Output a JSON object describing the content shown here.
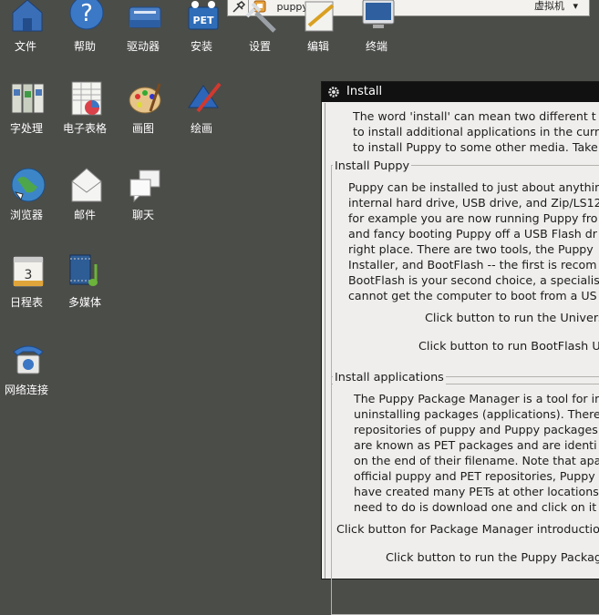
{
  "desktop": {
    "icons": [
      {
        "label": "文件"
      },
      {
        "label": "帮助"
      },
      {
        "label": "驱动器"
      },
      {
        "label": "安装"
      },
      {
        "label": "设置"
      },
      {
        "label": "编辑"
      },
      {
        "label": "终端"
      },
      {
        "label": "字处理"
      },
      {
        "label": "电子表格"
      },
      {
        "label": "画图"
      },
      {
        "label": "绘画"
      },
      {
        "label": "浏览器"
      },
      {
        "label": "邮件"
      },
      {
        "label": "聊天"
      },
      {
        "label": "日程表"
      },
      {
        "label": "多媒体"
      },
      {
        "label": "网络连接"
      }
    ],
    "install_icon_badge": "PET",
    "calendar_day": "3"
  },
  "taskbar": {
    "task_label": "puppy",
    "vm_label": "虚拟机",
    "vm_arrow": "▾"
  },
  "window": {
    "title": "Install",
    "intro": [
      "The word 'install' can mean two different t",
      "to install additional applications in the curr",
      "to install Puppy to some other media. Take"
    ],
    "install_puppy": {
      "legend": "Install Puppy",
      "lines": [
        "Puppy can be installed to just about anythin",
        "internal hard drive, USB drive, and Zip/LS12",
        "for example you are now running Puppy fro",
        "and fancy booting Puppy off a USB Flash dr",
        "right place. There are two tools, the Puppy",
        "Installer, and BootFlash -- the first is recom",
        "BootFlash is your second choice, a specialis",
        "cannot get the computer to boot from a US"
      ],
      "button1_text": "Click button to run the Univers",
      "button2_text": "Click button to run BootFlash US"
    },
    "install_apps": {
      "legend": "Install applications",
      "lines": [
        "The Puppy Package Manager is a tool for in",
        "uninstalling packages (applications). There",
        "repositories of puppy and Puppy packages",
        "are known as PET packages and are identi",
        "on the end of their filename. Note that apa",
        "official puppy and PET repositories, Puppy",
        "have created many PETs at other locations",
        "need to do is download one and click on it"
      ],
      "button1_text": "Click button for Package Manager introductio",
      "button2_text": "Click button to run the Puppy Packag"
    }
  }
}
